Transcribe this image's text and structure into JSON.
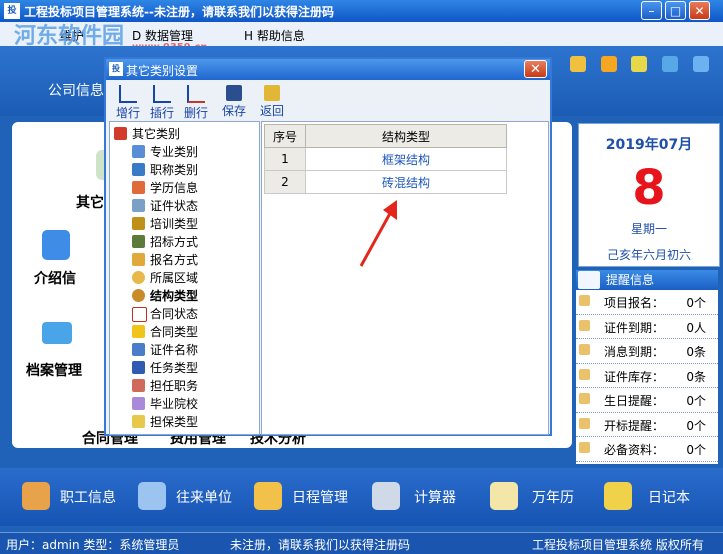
{
  "window": {
    "title": "工程投标项目管理系统--未注册，请联系我们以获得注册码",
    "app_icon_text": "投"
  },
  "menubar": {
    "items": [
      "维护",
      "D 数据管理",
      "H 帮助信息"
    ]
  },
  "watermark": {
    "text": "河东软件园",
    "url": "www.0359.cn"
  },
  "topnav": {
    "company_info": "公司信息"
  },
  "main_items": {
    "other": "其它",
    "intro": "介绍信",
    "archive": "档案管理",
    "contract": "合同管理",
    "cost": "费用管理",
    "tech": "技术分析"
  },
  "calendar": {
    "month": "2019年07月",
    "day": "8",
    "weekday": "星期一",
    "lunar": "己亥年六月初六"
  },
  "reminder": {
    "title": "提醒信息",
    "rows": [
      {
        "label": "项目报名：",
        "value": "0个"
      },
      {
        "label": "证件到期：",
        "value": "0人"
      },
      {
        "label": "消息到期：",
        "value": "0条"
      },
      {
        "label": "证件库存：",
        "value": "0条"
      },
      {
        "label": "生日提醒：",
        "value": "0个"
      },
      {
        "label": "开标提醒：",
        "value": "0个"
      },
      {
        "label": "必备资料：",
        "value": "0个"
      }
    ]
  },
  "bottombar": {
    "items": [
      "职工信息",
      "往来单位",
      "日程管理",
      "计算器",
      "万年历",
      "日记本"
    ]
  },
  "statusbar": {
    "user": "用户：admin  类型：系统管理员",
    "notice": "未注册，请联系我们以获得注册码",
    "product": "工程投标项目管理系统  版权所有"
  },
  "dialog": {
    "title": "其它类别设置",
    "close": "✕",
    "toolbar": [
      "增行",
      "插行",
      "删行",
      "保存",
      "返回"
    ],
    "tree": {
      "root": "其它类别",
      "items": [
        "专业类别",
        "职称类别",
        "学历信息",
        "证件状态",
        "培训类型",
        "招标方式",
        "报名方式",
        "所属区域",
        "结构类型",
        "合同状态",
        "合同类型",
        "证件名称",
        "任务类型",
        "担任职务",
        "毕业院校",
        "担保类型"
      ],
      "selected_index": 8
    },
    "grid": {
      "headers": [
        "序号",
        "结构类型"
      ],
      "rows": [
        {
          "no": "1",
          "name": "框架结构"
        },
        {
          "no": "2",
          "name": "砖混结构"
        }
      ]
    }
  }
}
